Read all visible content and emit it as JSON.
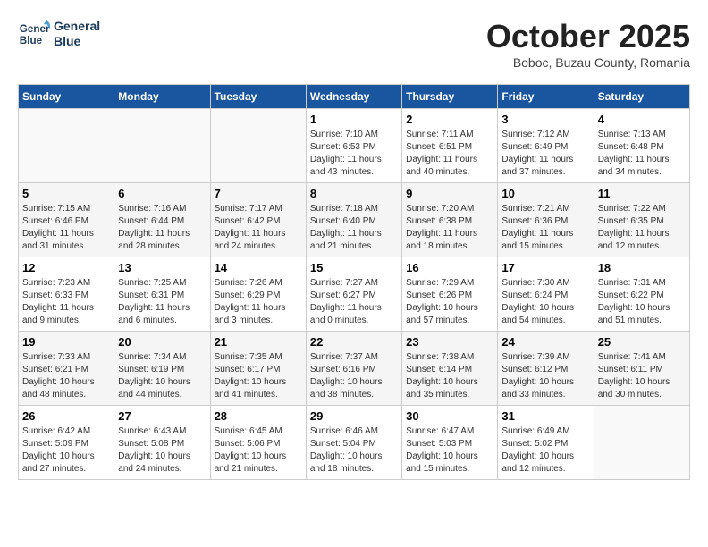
{
  "header": {
    "logo_line1": "General",
    "logo_line2": "Blue",
    "title": "October 2025",
    "location": "Boboc, Buzau County, Romania"
  },
  "weekdays": [
    "Sunday",
    "Monday",
    "Tuesday",
    "Wednesday",
    "Thursday",
    "Friday",
    "Saturday"
  ],
  "weeks": [
    [
      {
        "day": "",
        "info": ""
      },
      {
        "day": "",
        "info": ""
      },
      {
        "day": "",
        "info": ""
      },
      {
        "day": "1",
        "info": "Sunrise: 7:10 AM\nSunset: 6:53 PM\nDaylight: 11 hours\nand 43 minutes."
      },
      {
        "day": "2",
        "info": "Sunrise: 7:11 AM\nSunset: 6:51 PM\nDaylight: 11 hours\nand 40 minutes."
      },
      {
        "day": "3",
        "info": "Sunrise: 7:12 AM\nSunset: 6:49 PM\nDaylight: 11 hours\nand 37 minutes."
      },
      {
        "day": "4",
        "info": "Sunrise: 7:13 AM\nSunset: 6:48 PM\nDaylight: 11 hours\nand 34 minutes."
      }
    ],
    [
      {
        "day": "5",
        "info": "Sunrise: 7:15 AM\nSunset: 6:46 PM\nDaylight: 11 hours\nand 31 minutes."
      },
      {
        "day": "6",
        "info": "Sunrise: 7:16 AM\nSunset: 6:44 PM\nDaylight: 11 hours\nand 28 minutes."
      },
      {
        "day": "7",
        "info": "Sunrise: 7:17 AM\nSunset: 6:42 PM\nDaylight: 11 hours\nand 24 minutes."
      },
      {
        "day": "8",
        "info": "Sunrise: 7:18 AM\nSunset: 6:40 PM\nDaylight: 11 hours\nand 21 minutes."
      },
      {
        "day": "9",
        "info": "Sunrise: 7:20 AM\nSunset: 6:38 PM\nDaylight: 11 hours\nand 18 minutes."
      },
      {
        "day": "10",
        "info": "Sunrise: 7:21 AM\nSunset: 6:36 PM\nDaylight: 11 hours\nand 15 minutes."
      },
      {
        "day": "11",
        "info": "Sunrise: 7:22 AM\nSunset: 6:35 PM\nDaylight: 11 hours\nand 12 minutes."
      }
    ],
    [
      {
        "day": "12",
        "info": "Sunrise: 7:23 AM\nSunset: 6:33 PM\nDaylight: 11 hours\nand 9 minutes."
      },
      {
        "day": "13",
        "info": "Sunrise: 7:25 AM\nSunset: 6:31 PM\nDaylight: 11 hours\nand 6 minutes."
      },
      {
        "day": "14",
        "info": "Sunrise: 7:26 AM\nSunset: 6:29 PM\nDaylight: 11 hours\nand 3 minutes."
      },
      {
        "day": "15",
        "info": "Sunrise: 7:27 AM\nSunset: 6:27 PM\nDaylight: 11 hours\nand 0 minutes."
      },
      {
        "day": "16",
        "info": "Sunrise: 7:29 AM\nSunset: 6:26 PM\nDaylight: 10 hours\nand 57 minutes."
      },
      {
        "day": "17",
        "info": "Sunrise: 7:30 AM\nSunset: 6:24 PM\nDaylight: 10 hours\nand 54 minutes."
      },
      {
        "day": "18",
        "info": "Sunrise: 7:31 AM\nSunset: 6:22 PM\nDaylight: 10 hours\nand 51 minutes."
      }
    ],
    [
      {
        "day": "19",
        "info": "Sunrise: 7:33 AM\nSunset: 6:21 PM\nDaylight: 10 hours\nand 48 minutes."
      },
      {
        "day": "20",
        "info": "Sunrise: 7:34 AM\nSunset: 6:19 PM\nDaylight: 10 hours\nand 44 minutes."
      },
      {
        "day": "21",
        "info": "Sunrise: 7:35 AM\nSunset: 6:17 PM\nDaylight: 10 hours\nand 41 minutes."
      },
      {
        "day": "22",
        "info": "Sunrise: 7:37 AM\nSunset: 6:16 PM\nDaylight: 10 hours\nand 38 minutes."
      },
      {
        "day": "23",
        "info": "Sunrise: 7:38 AM\nSunset: 6:14 PM\nDaylight: 10 hours\nand 35 minutes."
      },
      {
        "day": "24",
        "info": "Sunrise: 7:39 AM\nSunset: 6:12 PM\nDaylight: 10 hours\nand 33 minutes."
      },
      {
        "day": "25",
        "info": "Sunrise: 7:41 AM\nSunset: 6:11 PM\nDaylight: 10 hours\nand 30 minutes."
      }
    ],
    [
      {
        "day": "26",
        "info": "Sunrise: 6:42 AM\nSunset: 5:09 PM\nDaylight: 10 hours\nand 27 minutes."
      },
      {
        "day": "27",
        "info": "Sunrise: 6:43 AM\nSunset: 5:08 PM\nDaylight: 10 hours\nand 24 minutes."
      },
      {
        "day": "28",
        "info": "Sunrise: 6:45 AM\nSunset: 5:06 PM\nDaylight: 10 hours\nand 21 minutes."
      },
      {
        "day": "29",
        "info": "Sunrise: 6:46 AM\nSunset: 5:04 PM\nDaylight: 10 hours\nand 18 minutes."
      },
      {
        "day": "30",
        "info": "Sunrise: 6:47 AM\nSunset: 5:03 PM\nDaylight: 10 hours\nand 15 minutes."
      },
      {
        "day": "31",
        "info": "Sunrise: 6:49 AM\nSunset: 5:02 PM\nDaylight: 10 hours\nand 12 minutes."
      },
      {
        "day": "",
        "info": ""
      }
    ]
  ]
}
